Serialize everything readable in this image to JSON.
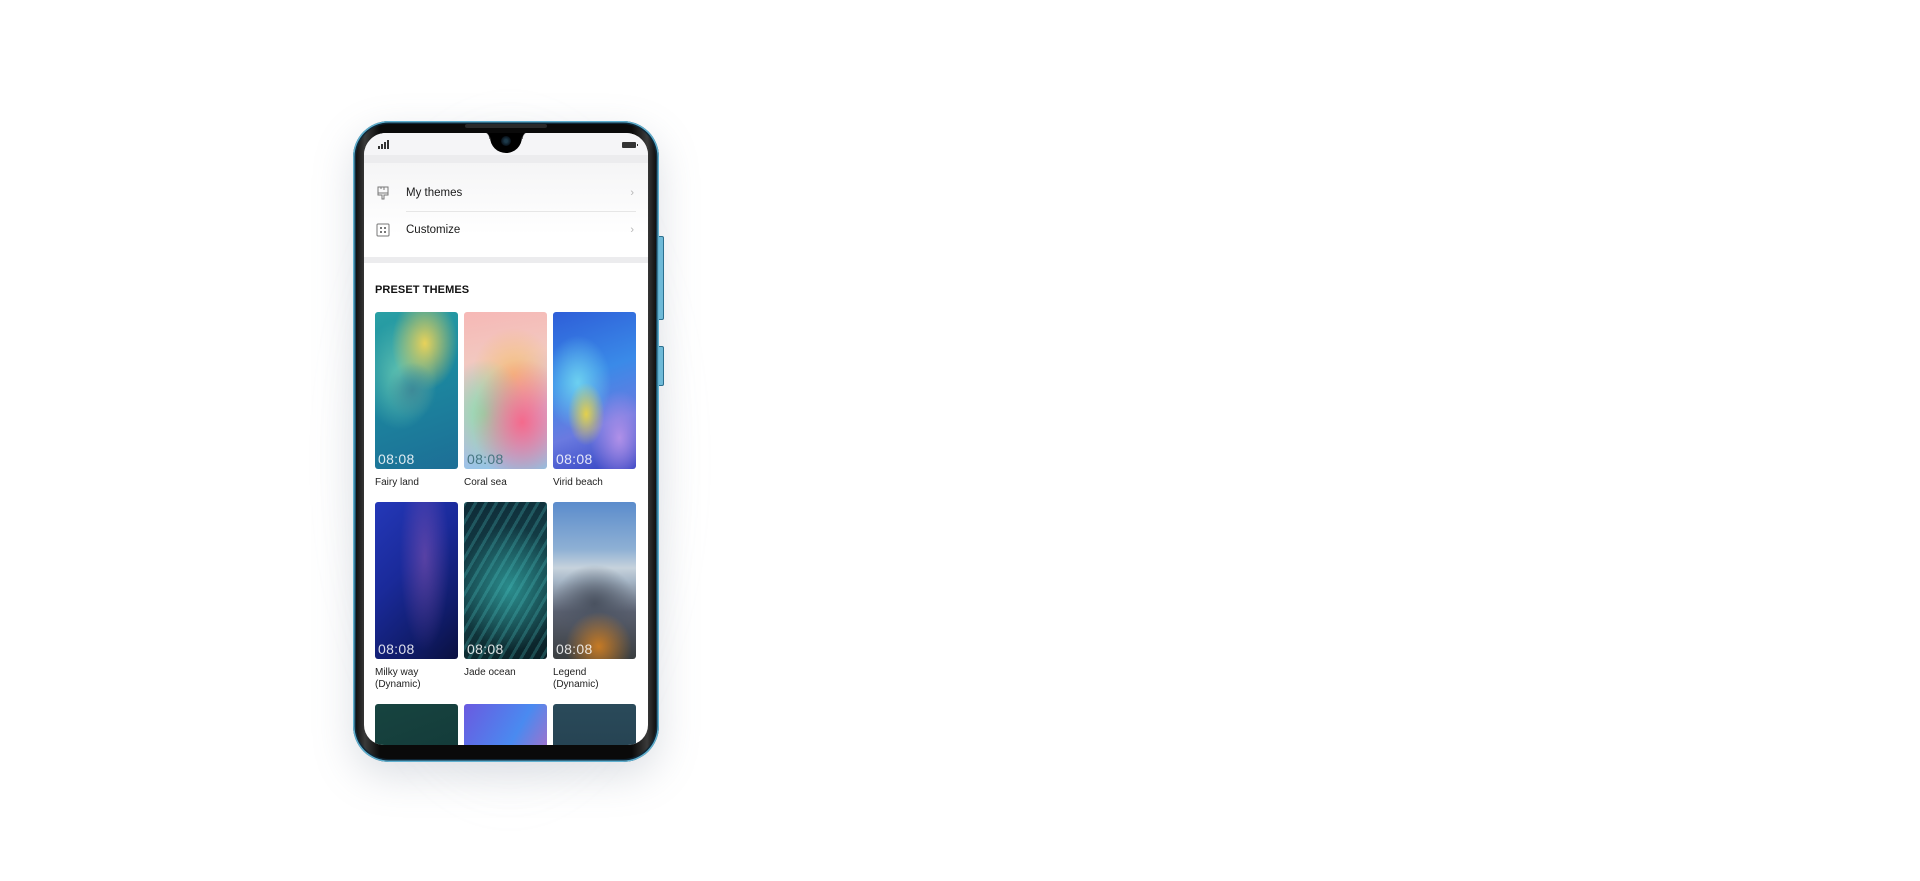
{
  "status_bar": {
    "signal_icon": "signal-bars-icon",
    "battery_icon": "battery-full-icon"
  },
  "menu": {
    "items": [
      {
        "label": "My themes",
        "icon": "paintbrush-icon",
        "chevron": "›"
      },
      {
        "label": "Customize",
        "icon": "grid-dots-icon",
        "chevron": "›"
      }
    ]
  },
  "preset_themes": {
    "title": "PRESET THEMES",
    "items": [
      {
        "name": "Fairy land",
        "time": "08:08"
      },
      {
        "name": "Coral sea",
        "time": "08:08"
      },
      {
        "name": "Virid beach",
        "time": "08:08"
      },
      {
        "name": "Milky way\n(Dynamic)",
        "time": "08:08"
      },
      {
        "name": "Jade ocean",
        "time": "08:08"
      },
      {
        "name": "Legend\n(Dynamic)",
        "time": "08:08"
      }
    ]
  }
}
